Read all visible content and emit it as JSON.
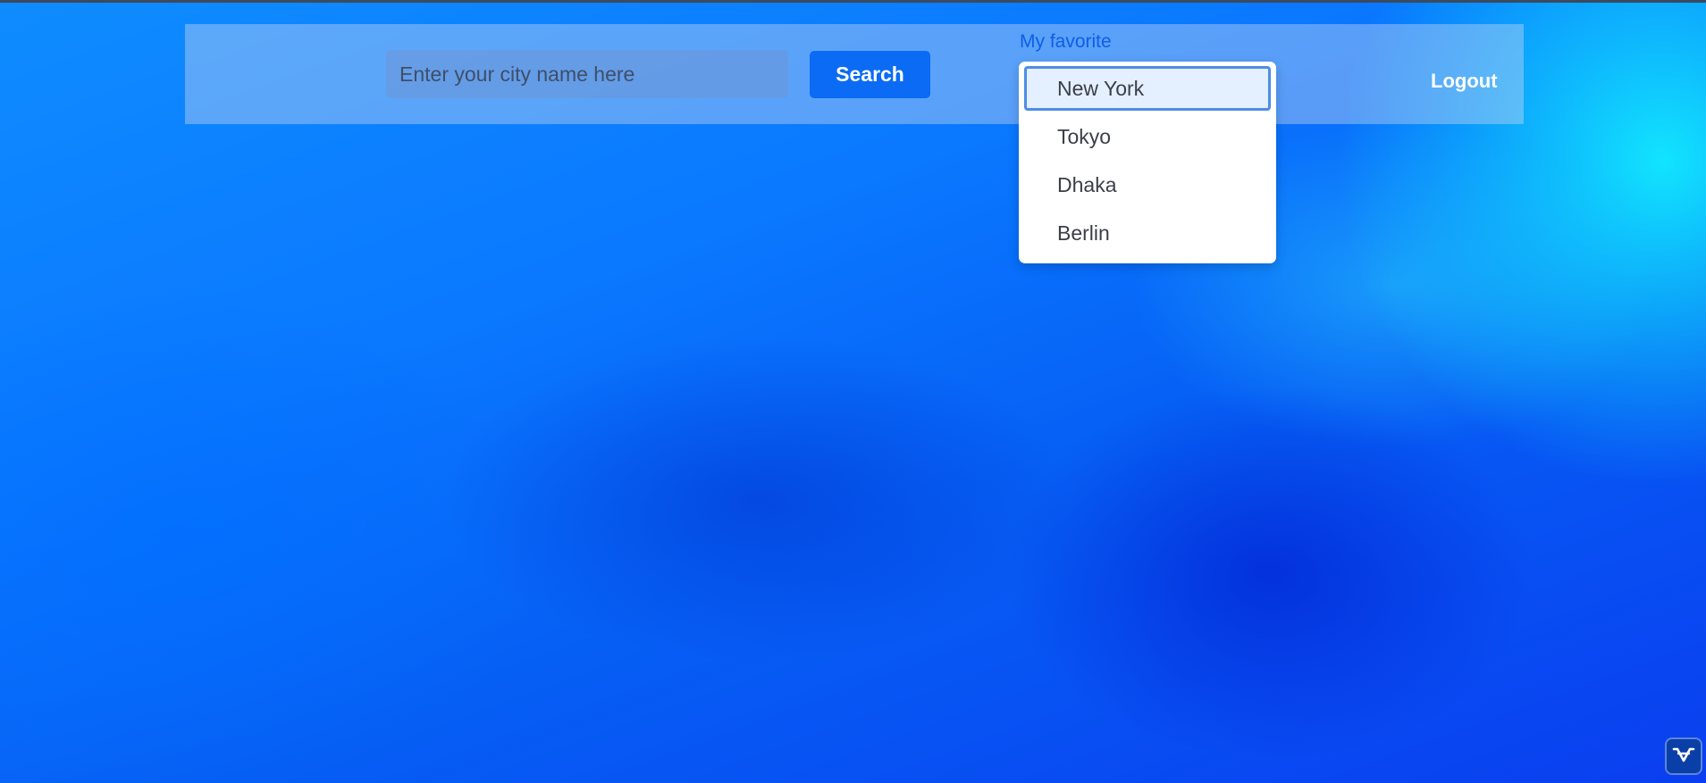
{
  "header": {
    "search": {
      "placeholder": "Enter your city name here",
      "value": ""
    },
    "search_label": "Search",
    "favorite_label": "My favorite",
    "logout_label": "Logout"
  },
  "favorites_menu": {
    "items": [
      {
        "label": "New York",
        "active": true
      },
      {
        "label": "Tokyo",
        "active": false
      },
      {
        "label": "Dhaka",
        "active": false
      },
      {
        "label": "Berlin",
        "active": false
      }
    ]
  },
  "icons": {
    "corner_badge": "vaadin-logo-icon"
  },
  "colors": {
    "accent": "#0b6bf5",
    "link": "#0d5fe6",
    "active_item_border": "#4d8de6",
    "active_item_bg": "#e4efff"
  }
}
